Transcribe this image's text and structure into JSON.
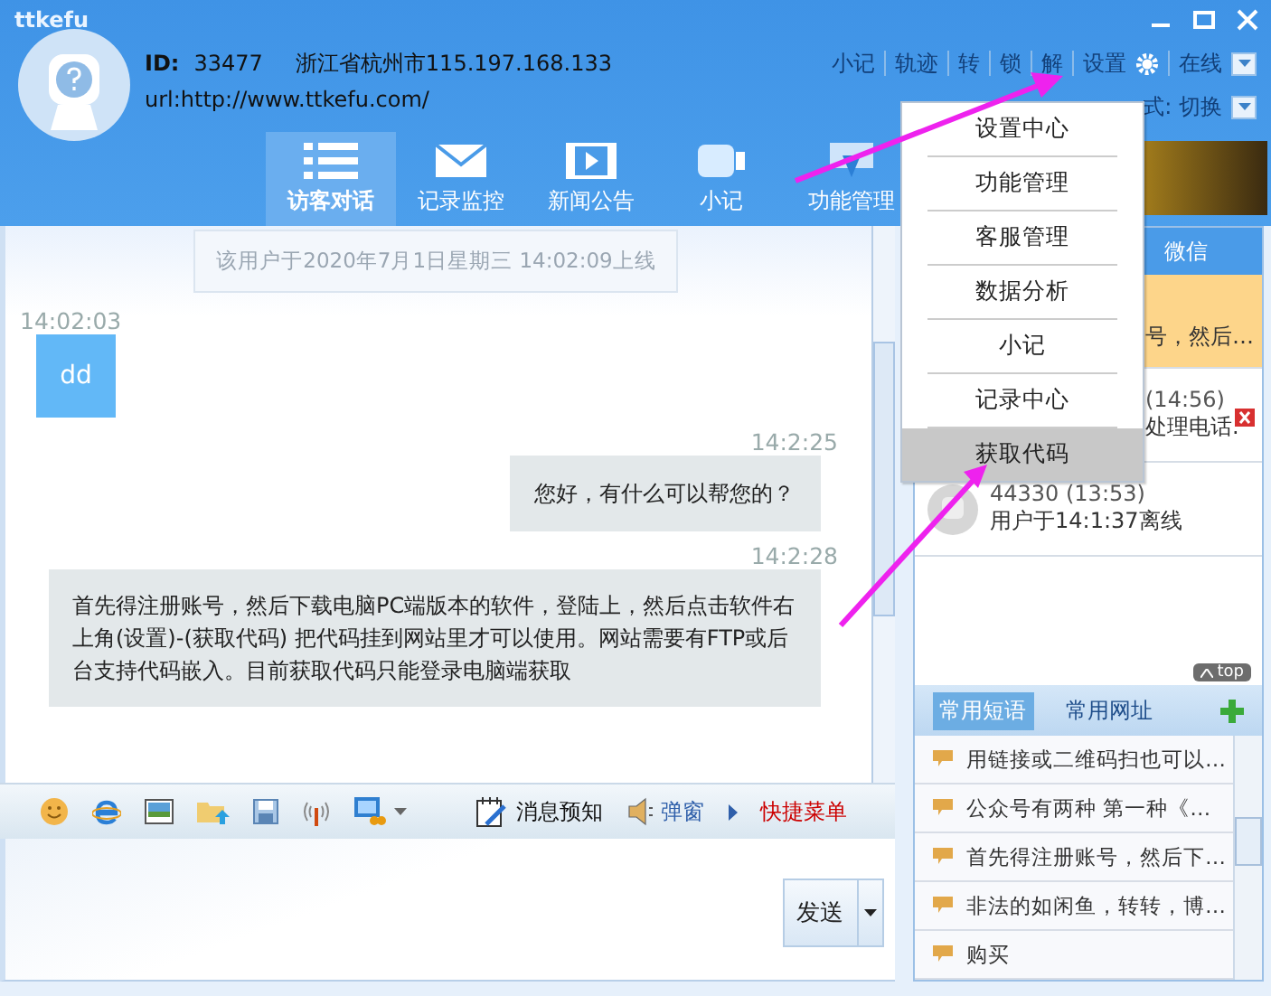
{
  "window": {
    "title": "ttkefu"
  },
  "visitor": {
    "id_label": "ID:",
    "id": "33477",
    "location": "浙江省杭州市115.197.168.133",
    "url": "url:http://www.ttkefu.com/"
  },
  "top_links": [
    {
      "label": "小记"
    },
    {
      "label": "轨迹"
    },
    {
      "label": "转"
    },
    {
      "label": "锁"
    },
    {
      "label": "解"
    }
  ],
  "settings_link": "设置",
  "status": "在线",
  "mode_label": "式: 切换",
  "nav_tabs": [
    {
      "label": "访客对话",
      "kind": "list",
      "selected": true
    },
    {
      "label": "记录监控",
      "kind": "mail",
      "selected": false
    },
    {
      "label": "新闻公告",
      "kind": "film",
      "selected": false
    },
    {
      "label": "小记",
      "kind": "note",
      "selected": false
    },
    {
      "label": "功能管理",
      "kind": "download",
      "selected": false
    }
  ],
  "settings_menu": [
    {
      "label": "设置中心",
      "selected": false
    },
    {
      "label": "功能管理",
      "selected": false
    },
    {
      "label": "客服管理",
      "selected": false
    },
    {
      "label": "数据分析",
      "selected": false
    },
    {
      "label": "小记",
      "selected": false
    },
    {
      "label": "记录中心",
      "selected": false
    },
    {
      "label": "获取代码",
      "selected": true
    }
  ],
  "chat": {
    "notice": "该用户于2020年7月1日星期三 14:02:09上线",
    "messages": [
      {
        "kind": "visitor",
        "time": "14:02:03",
        "text": "dd"
      },
      {
        "kind": "agent",
        "time": "14:2:25",
        "text": "您好，有什么可以帮您的？"
      },
      {
        "kind": "agent",
        "time": "14:2:28",
        "text": "首先得注册账号，然后下载电脑PC端版本的软件，登陆上，然后点击软件右上角(设置)-(获取代码) 把代码挂到网站里才可以使用。网站需要有FTP或后台支持代码嵌入。目前获取代码只能登录电脑端获取"
      }
    ]
  },
  "toolbar": {
    "notify": "消息预知",
    "popup": "弹窗",
    "quick_menu": "快捷菜单"
  },
  "send_button": "发送",
  "sessions": {
    "tab": "微信",
    "items": [
      {
        "selected": true,
        "text": "号，然后…",
        "closable": false
      },
      {
        "selected": false,
        "title": "(14:56)",
        "text": "处理电话.",
        "closable": true
      },
      {
        "selected": false,
        "title": "44330 (13:53)",
        "text": "用户于14:1:37离线",
        "closable": false
      }
    ]
  },
  "top_badge": "top",
  "phrase_tabs": [
    {
      "label": "常用短语",
      "selected": true
    },
    {
      "label": "常用网址",
      "selected": false
    }
  ],
  "phrases": [
    "用链接或二维码扫也可以…",
    "公众号有两种 第一种《…",
    "首先得注册账号，然后下…",
    "非法的如闲鱼，转转，博…",
    "购买"
  ]
}
